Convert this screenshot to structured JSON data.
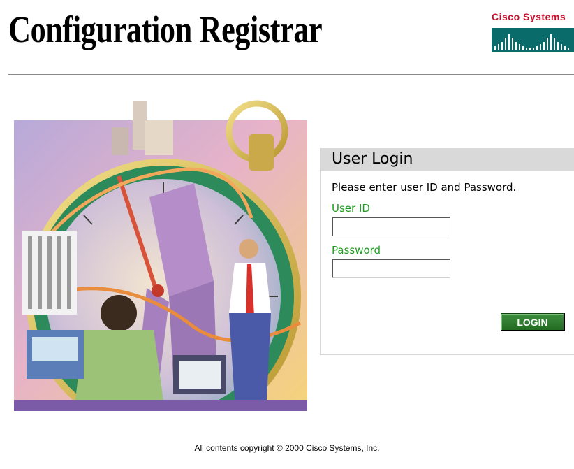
{
  "header": {
    "title": "Configuration Registrar",
    "brand": {
      "name": "Cisco Systems",
      "color": "#c8102e",
      "bars_color": "#0a6b6b"
    }
  },
  "illustration": {
    "icon": "stopwatch-business-illustration"
  },
  "login": {
    "title": "User Login",
    "instructions": "Please enter user ID and Password.",
    "user_id_label": "User ID",
    "user_id_value": "",
    "password_label": "Password",
    "password_value": "",
    "button_label": "LOGIN",
    "label_color": "#229922",
    "button_color": "#2e7d2e",
    "header_bg": "#d9d9d9"
  },
  "footer": {
    "copyright": "All contents copyright © 2000 Cisco Systems, Inc."
  }
}
